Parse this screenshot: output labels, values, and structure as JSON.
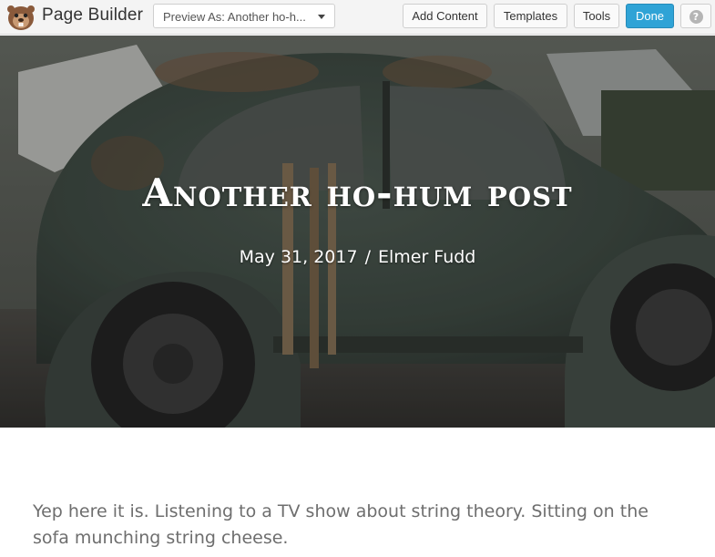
{
  "topbar": {
    "brand": "Page Builder",
    "logo_icon": "beaver-logo-icon",
    "preview_select": {
      "value": "Preview As: Another ho-h..."
    },
    "buttons": {
      "add_content": "Add Content",
      "templates": "Templates",
      "tools": "Tools",
      "done": "Done",
      "help": "?"
    },
    "colors": {
      "done": "#2fa3d6"
    }
  },
  "hero": {
    "title": "Another ho-hum post",
    "date": "May 31, 2017",
    "separator": "/",
    "author": "Elmer Fudd"
  },
  "post": {
    "body": "Yep here it is. Listening to a TV show about string theory. Sitting on the sofa munching string cheese."
  }
}
